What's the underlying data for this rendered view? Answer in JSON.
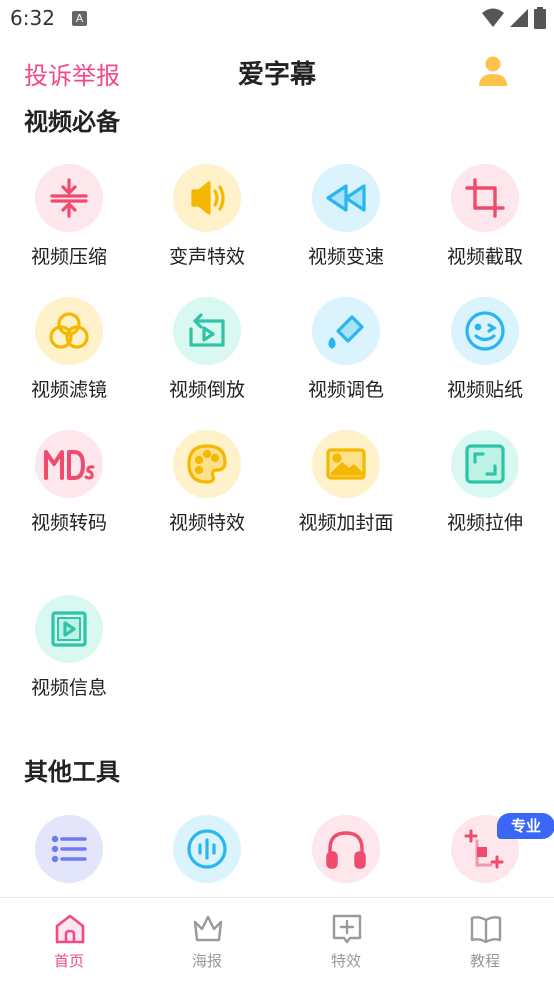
{
  "status_bar": {
    "time": "6:32",
    "notification_glyph": "A"
  },
  "header": {
    "complain_label": "投诉举报",
    "title": "爱字幕",
    "profile_icon": "user-icon"
  },
  "sections": [
    {
      "title": "视频必备",
      "items": [
        {
          "label": "视频压缩",
          "icon": "compress-icon"
        },
        {
          "label": "变声特效",
          "icon": "speaker-icon"
        },
        {
          "label": "视频变速",
          "icon": "rewind-icon"
        },
        {
          "label": "视频截取",
          "icon": "crop-icon"
        },
        {
          "label": "视频滤镜",
          "icon": "filter-icon"
        },
        {
          "label": "视频倒放",
          "icon": "reverse-play-icon"
        },
        {
          "label": "视频调色",
          "icon": "paint-bucket-icon"
        },
        {
          "label": "视频贴纸",
          "icon": "smiley-icon"
        },
        {
          "label": "视频转码",
          "icon": "mds-icon"
        },
        {
          "label": "视频特效",
          "icon": "palette-icon"
        },
        {
          "label": "视频加封面",
          "icon": "image-icon"
        },
        {
          "label": "视频拉伸",
          "icon": "stretch-icon"
        },
        {
          "label": "视频信息",
          "icon": "video-info-icon"
        }
      ]
    },
    {
      "title": "其他工具",
      "items": [
        {
          "label": "",
          "icon": "list-icon"
        },
        {
          "label": "",
          "icon": "voice-icon"
        },
        {
          "label": "",
          "icon": "headphones-icon"
        },
        {
          "label": "",
          "icon": "grid-plus-icon",
          "badge": "专业"
        }
      ]
    }
  ],
  "tabs": [
    {
      "label": "首页",
      "icon": "home-icon",
      "active": true
    },
    {
      "label": "海报",
      "icon": "crown-icon",
      "active": false
    },
    {
      "label": "特效",
      "icon": "plus-box-icon",
      "active": false
    },
    {
      "label": "教程",
      "icon": "book-icon",
      "active": false
    }
  ],
  "colors": {
    "accent": "#f04a8c",
    "tab_inactive": "#9a9a9a",
    "badge": "#3a67f5"
  }
}
